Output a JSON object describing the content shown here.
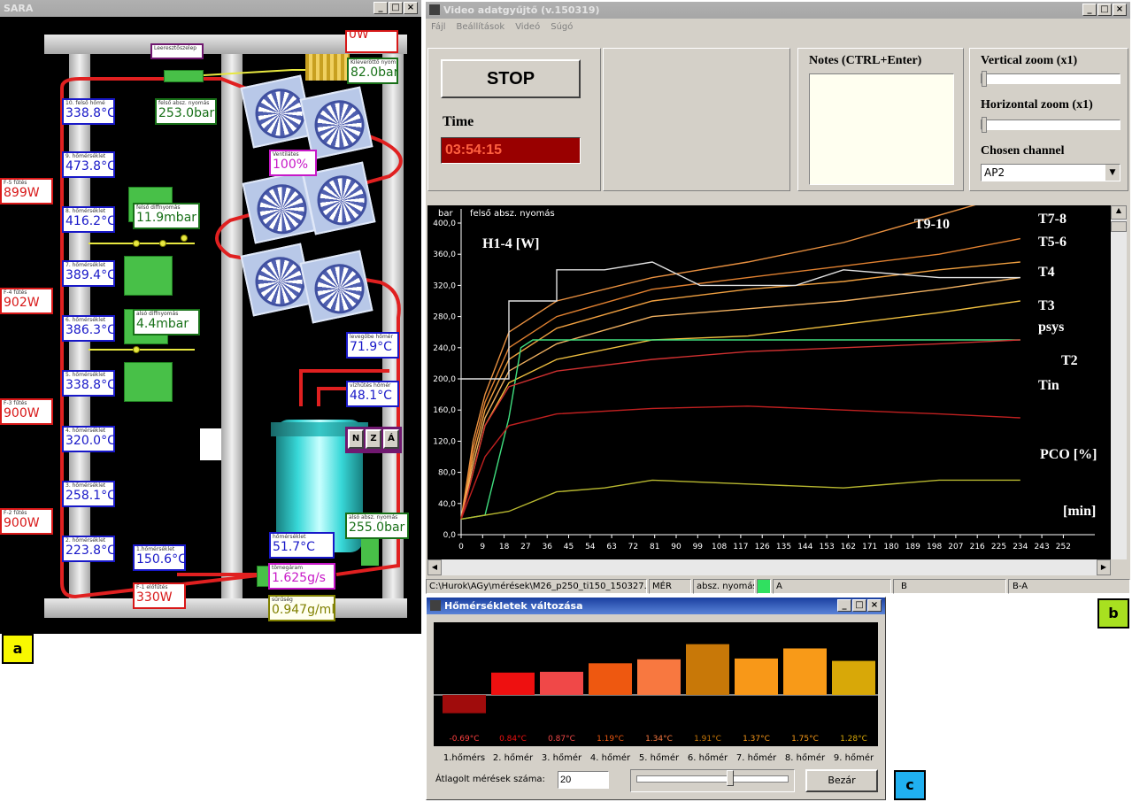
{
  "panel_a": {
    "title": "SARA",
    "badge": "a",
    "labels": {
      "heater_top": {
        "sub": "",
        "value": "0W"
      },
      "valve_top": {
        "sub": "Leeresztőszelep",
        "value": ""
      },
      "outlet_pressure": {
        "sub": "Kileveröttő nyom",
        "value": "82.0bar"
      },
      "upper_abs_pressure": {
        "sub": "felső absz. nyomás",
        "value": "253.0bar"
      },
      "t10": {
        "sub": "10. felső hőmé",
        "value": "338.8°C"
      },
      "t9": {
        "sub": "9. hőmérséklet",
        "value": "473.8°C"
      },
      "t8": {
        "sub": "8. hőmérséklet",
        "value": "416.2°C"
      },
      "t7": {
        "sub": "7. hőmérséklet",
        "value": "389.4°C"
      },
      "t6": {
        "sub": "6. hőmérséklet",
        "value": "386.3°C"
      },
      "t5": {
        "sub": "5. hőmérséklet",
        "value": "338.8°C"
      },
      "t4": {
        "sub": "4. hőmérséklet",
        "value": "320.0°C"
      },
      "t3": {
        "sub": "3. hőmérséklet",
        "value": "258.1°C"
      },
      "t2": {
        "sub": "2. hőmérséklet",
        "value": "223.8°C"
      },
      "t1": {
        "sub": "1.hőmérséklet",
        "value": "150.6°C"
      },
      "f5": {
        "sub": "F-5 fűtés",
        "value": "899W"
      },
      "f4": {
        "sub": "F-4 fűtés",
        "value": "902W"
      },
      "f3": {
        "sub": "F-3 fűtés",
        "value": "900W"
      },
      "f2": {
        "sub": "F-2 fűtés",
        "value": "900W"
      },
      "f1": {
        "sub": "F-1 előfűtés",
        "value": "330W"
      },
      "upper_diff": {
        "sub": "felső diffnyomás",
        "value": "11.9mbar"
      },
      "lower_diff": {
        "sub": "alsó diffnyomás",
        "value": "4.4mbar"
      },
      "fan": {
        "sub": "Ventilátes",
        "value": "100%"
      },
      "cooler_temp": {
        "sub": "levegőbe hőmér",
        "value": "71.9°C"
      },
      "water_temp": {
        "sub": "vízhűtés hőmér",
        "value": "48.1°C"
      },
      "lower_abs_pressure": {
        "sub": "alsó absz. nyomás",
        "value": "255.0bar"
      },
      "temp": {
        "sub": "hőmérséklet",
        "value": "51.7°C"
      },
      "flow": {
        "sub": "tömegáram",
        "value": "1.625g/s"
      },
      "density": {
        "sub": "sűrűség",
        "value": "0.947g/ml"
      }
    },
    "nza": [
      "N",
      "Z",
      "Á"
    ]
  },
  "panel_b": {
    "title": "Video adatgyűjtő (v.150319)",
    "badge": "b",
    "menu": [
      "Fájl",
      "Beállítások",
      "Videó",
      "Súgó"
    ],
    "stop_label": "STOP",
    "time_label": "Time",
    "time_value": "03:54:15",
    "notes_label": "Notes (CTRL+Enter)",
    "vzoom_label": "Vertical zoom (x1)",
    "hzoom_label": "Horizontal zoom (x1)",
    "channel_label": "Chosen channel",
    "channel_value": "AP2",
    "status": {
      "path": "C:\\Hurok\\AGy\\mérések\\M26_p250_ti150_150327.m",
      "mode": "MÉR",
      "channel": "absz. nyomás",
      "a": "A",
      "b": "B",
      "ba": "B-A"
    }
  },
  "chart_data": {
    "type": "line",
    "title": "felső absz. nyomás",
    "ylabel": "bar",
    "xlabel_annot": "[min]",
    "yticks": [
      "0,0",
      "40,0",
      "80,0",
      "120,0",
      "160,0",
      "200,0",
      "240,0",
      "280,0",
      "320,0",
      "360,0",
      "400,0"
    ],
    "xticks": [
      "0",
      "9",
      "18",
      "27",
      "36",
      "45",
      "54",
      "63",
      "72",
      "81",
      "90",
      "99",
      "108",
      "117",
      "126",
      "135",
      "144",
      "153",
      "162",
      "171",
      "180",
      "189",
      "198",
      "207",
      "216",
      "225",
      "234",
      "243",
      "252"
    ],
    "xlim": [
      0,
      260
    ],
    "ylim": [
      0,
      400
    ],
    "series": [
      {
        "name": "T9-10",
        "color": "#e89040",
        "x": [
          0,
          5,
          10,
          20,
          40,
          80,
          120,
          160,
          200,
          234
        ],
        "y": [
          20,
          120,
          180,
          260,
          300,
          330,
          350,
          375,
          410,
          440
        ]
      },
      {
        "name": "T7-8",
        "color": "#e08030",
        "x": [
          0,
          5,
          10,
          20,
          40,
          80,
          120,
          160,
          200,
          234
        ],
        "y": [
          20,
          110,
          170,
          240,
          280,
          315,
          330,
          345,
          360,
          380
        ]
      },
      {
        "name": "T5-6",
        "color": "#f0a040",
        "x": [
          0,
          5,
          10,
          20,
          40,
          80,
          120,
          160,
          200,
          234
        ],
        "y": [
          20,
          100,
          160,
          225,
          265,
          300,
          315,
          325,
          340,
          350
        ]
      },
      {
        "name": "T4",
        "color": "#f0b060",
        "x": [
          0,
          5,
          10,
          20,
          40,
          80,
          120,
          160,
          200,
          234
        ],
        "y": [
          20,
          90,
          150,
          210,
          245,
          280,
          290,
          300,
          315,
          330
        ]
      },
      {
        "name": "T3",
        "color": "#f0c040",
        "x": [
          0,
          5,
          10,
          20,
          40,
          80,
          120,
          160,
          200,
          234
        ],
        "y": [
          20,
          80,
          140,
          195,
          225,
          250,
          255,
          270,
          285,
          300
        ]
      },
      {
        "name": "psys",
        "color": "#40e080",
        "x": [
          0,
          10,
          20,
          25,
          30,
          234
        ],
        "y": [
          20,
          25,
          150,
          240,
          250,
          250
        ]
      },
      {
        "name": "T2",
        "color": "#d03030",
        "x": [
          0,
          5,
          10,
          20,
          40,
          80,
          120,
          160,
          200,
          234
        ],
        "y": [
          20,
          80,
          140,
          190,
          210,
          225,
          235,
          240,
          245,
          250
        ]
      },
      {
        "name": "Tin",
        "color": "#c02020",
        "x": [
          0,
          5,
          10,
          20,
          40,
          80,
          120,
          160,
          200,
          234
        ],
        "y": [
          20,
          60,
          100,
          140,
          155,
          162,
          165,
          160,
          155,
          150
        ]
      },
      {
        "name": "H1-4",
        "color": "#e0e0e0",
        "x": [
          0,
          20,
          20,
          40,
          40,
          60,
          80,
          100,
          140,
          160,
          200,
          234
        ],
        "y": [
          200,
          200,
          300,
          300,
          340,
          340,
          350,
          320,
          320,
          340,
          330,
          330
        ]
      },
      {
        "name": "PCO",
        "color": "#b8b830",
        "x": [
          0,
          20,
          40,
          60,
          80,
          120,
          160,
          200,
          234
        ],
        "y": [
          20,
          30,
          55,
          60,
          70,
          65,
          60,
          70,
          70
        ]
      }
    ],
    "annotations": [
      "H1-4 [W]",
      "T9-10",
      "T7-8",
      "T5-6",
      "T4",
      "T3",
      "psys",
      "T2",
      "Tin",
      "PCO [%]",
      "[min]"
    ]
  },
  "panel_c": {
    "title": "Hőmérsékletek változása",
    "badge": "c",
    "bars": [
      {
        "value": -0.69,
        "label": "-0.69°C",
        "color": "#a00c0c",
        "name": "1.hőmérs"
      },
      {
        "value": 0.84,
        "label": "0.84°C",
        "color": "#ee1010",
        "name": "2. hőmér"
      },
      {
        "value": 0.87,
        "label": "0.87°C",
        "color": "#f04848",
        "name": "3. hőmér"
      },
      {
        "value": 1.19,
        "label": "1.19°C",
        "color": "#ee5810",
        "name": "4. hőmér"
      },
      {
        "value": 1.34,
        "label": "1.34°C",
        "color": "#f87840",
        "name": "5. hőmér"
      },
      {
        "value": 1.91,
        "label": "1.91°C",
        "color": "#c87808",
        "name": "6. hőmér"
      },
      {
        "value": 1.37,
        "label": "1.37°C",
        "color": "#f89818",
        "name": "7. hőmér"
      },
      {
        "value": 1.75,
        "label": "1.75°C",
        "color": "#f89a18",
        "name": "8. hőmér"
      },
      {
        "value": 1.28,
        "label": "1.28°C",
        "color": "#d8a808",
        "name": "9. hőmér"
      }
    ],
    "avg_label": "Átlagolt mérések száma:",
    "avg_value": "20",
    "close_label": "Bezár"
  }
}
